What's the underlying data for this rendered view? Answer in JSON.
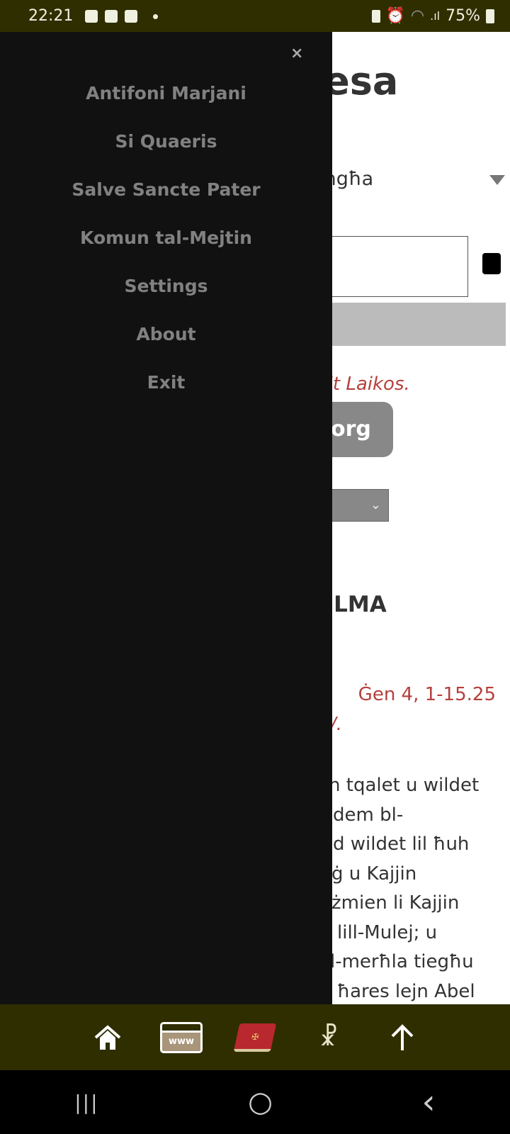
{
  "status_bar": {
    "time": "22:21",
    "battery": "75%",
    "icons": [
      "gallery-icon",
      "facebook-icon",
      "clock-app-icon",
      "dot-icon",
      "battery-saver-icon",
      "alarm-icon",
      "wifi-icon",
      "signal-icon",
      "battery-icon"
    ]
  },
  "page": {
    "title_fragment": "diesa",
    "week_select": "Ġimgħa",
    "notice_fragment": "ri s-sit Laikos.",
    "button_fragment": "org",
    "section_fragment": "ELMA",
    "reference": "Ġen 4, 1-15.25",
    "reference_tail": "/.",
    "body_lines": [
      "n tqalet u wildet",
      "dem bl-",
      "d wildet lil ħuh",
      "ġ u Kajjin",
      "żmien li Kajjin",
      "lill-Mulej; u",
      "l-merħla tiegħu",
      "ħares lejn Abel"
    ],
    "colors": {
      "accent_red": "#b5403c",
      "text": "#333333"
    }
  },
  "drawer": {
    "close": "×",
    "items": [
      "Antifoni Marjani",
      "Si Quaeris",
      "Salve Sancte Pater",
      "Komun tal-Mejtin",
      "Settings",
      "About",
      "Exit"
    ]
  },
  "bottom_bar": {
    "icons": [
      "home-icon",
      "website-icon",
      "breviary-book-icon",
      "praying-hands-icon",
      "arrow-up-icon"
    ],
    "www_label": "www"
  },
  "nav_bar": {
    "recents": "|||",
    "home": "○",
    "back": "‹"
  }
}
